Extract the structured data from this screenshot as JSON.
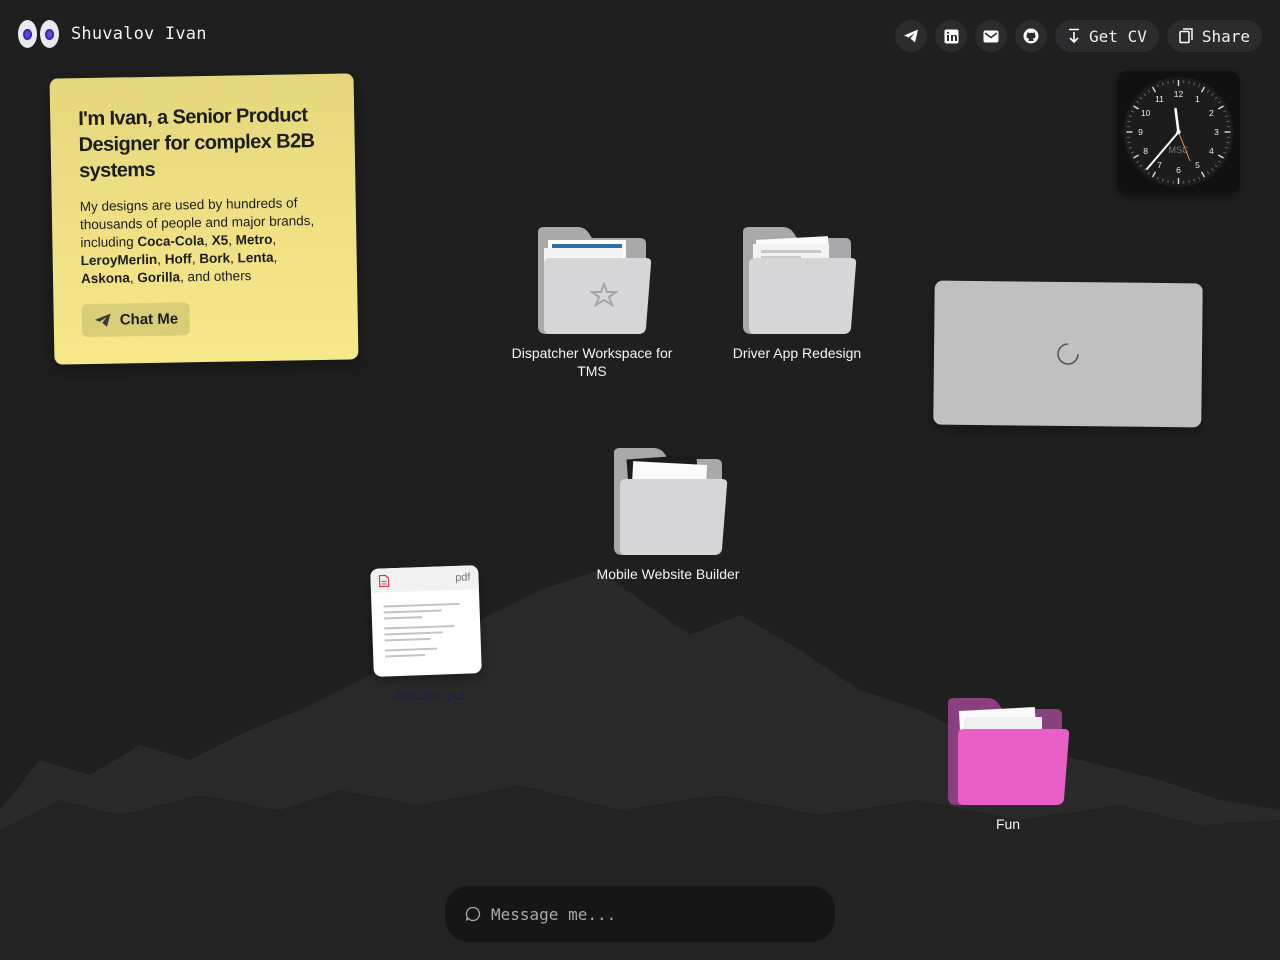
{
  "header": {
    "name": "Shuvalov Ivan",
    "get_cv_label": "Get CV",
    "share_label": "Share",
    "icons": [
      "telegram-icon",
      "linkedin-icon",
      "mail-icon",
      "github-icon"
    ]
  },
  "note": {
    "title": "I'm Ivan, a Senior Product Designer for complex B2B systems",
    "body_prefix": "My designs are used by hundreds of thousands of people and major brands, including ",
    "brands": [
      "Coca-Cola",
      "X5",
      "Metro",
      "LeroyMerlin",
      "Hoff",
      "Bork",
      "Lenta",
      "Askona",
      "Gorilla"
    ],
    "body_suffix": ", and others",
    "chat_label": "Chat Me",
    "color": "#f2e386"
  },
  "clock": {
    "label": "MSC",
    "numbers": [
      "12",
      "1",
      "2",
      "3",
      "4",
      "5",
      "6",
      "7",
      "8",
      "9",
      "10",
      "11"
    ]
  },
  "folders": [
    {
      "label": "Dispatcher Workspace for TMS"
    },
    {
      "label": "Driver App Redesign"
    },
    {
      "label": "Mobile Website Builder"
    },
    {
      "label": "Fun"
    }
  ],
  "resume": {
    "ext": "pdf",
    "label": "Resume.pdf"
  },
  "message": {
    "placeholder": "Message me..."
  },
  "colors": {
    "background": "#1f1f20",
    "fun_folder": "#e85fc7",
    "accent_pupil": "#5b4bd6"
  }
}
